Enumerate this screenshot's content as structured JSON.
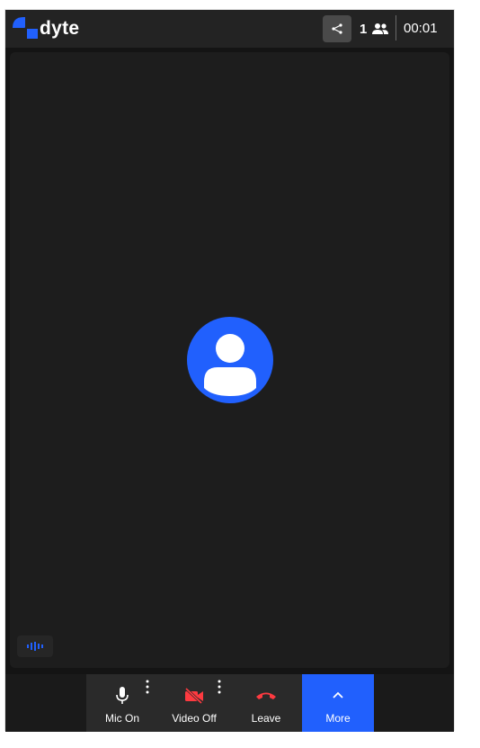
{
  "header": {
    "brand": "dyte",
    "participant_count": "1",
    "timer": "00:01",
    "icons": [
      "dyte-logo-icon",
      "share-icon",
      "people-icon"
    ]
  },
  "stage": {
    "avatar_icon": "person-icon",
    "audio_indicator_icon": "audio-waveform-icon"
  },
  "controls": {
    "mic": {
      "label": "Mic On",
      "icon": "microphone-icon"
    },
    "video": {
      "label": "Video Off",
      "icon": "video-off-icon"
    },
    "leave": {
      "label": "Leave",
      "icon": "phone-hangup-icon"
    },
    "more": {
      "label": "More",
      "icon": "chevron-up-icon"
    }
  },
  "colors": {
    "accent": "#2160fd",
    "danger": "#fd3a40",
    "background": "#141414",
    "header": "#232323",
    "tile": "#1d1d1d",
    "control": "#2a2a2a"
  }
}
